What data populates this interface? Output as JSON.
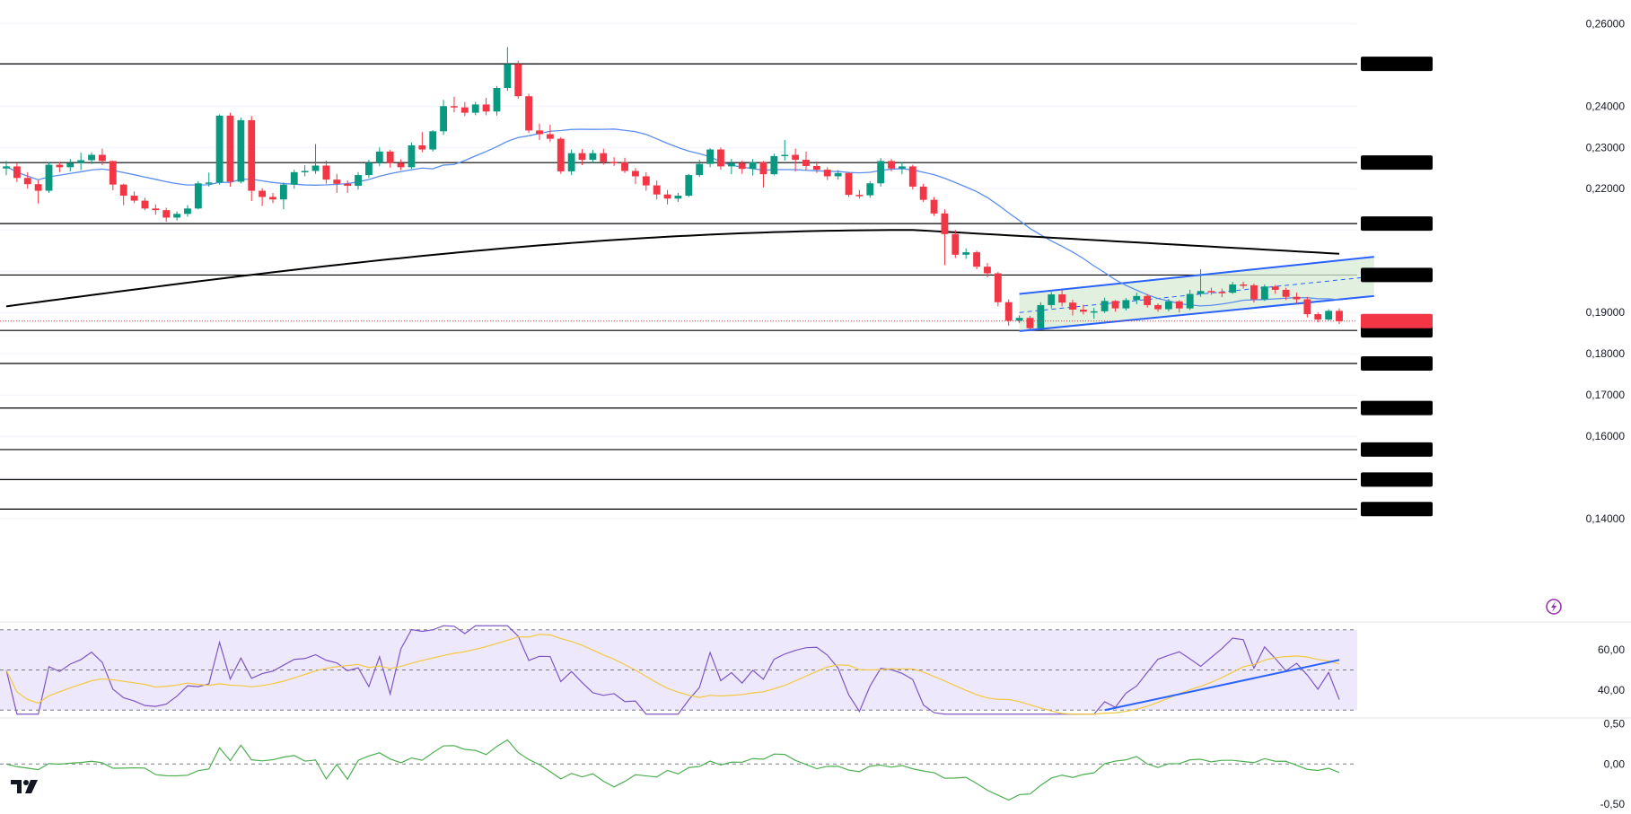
{
  "chart_data": {
    "type": "candlestick",
    "price_axis": {
      "ylim": [
        0.1383,
        0.2618
      ],
      "ticks": [
        "0,26000",
        "0,24000",
        "0,23000",
        "0,22000",
        "0,19000",
        "0,18000",
        "0,17000",
        "0,16000",
        "0,14000"
      ]
    },
    "horizontal_levels": [
      {
        "value": 0.25025,
        "label": "0,25025"
      },
      {
        "value": 0.22632,
        "label": "0,22632"
      },
      {
        "value": 0.21154,
        "label": "0,21154"
      },
      {
        "value": 0.19909,
        "label": "0,19909"
      },
      {
        "value": 0.18566,
        "label": "0,18566"
      },
      {
        "value": 0.17766,
        "label": "0,17766"
      },
      {
        "value": 0.16686,
        "label": "0,16686"
      },
      {
        "value": 0.1568,
        "label": "0,15680"
      },
      {
        "value": 0.14952,
        "label": "0,14952"
      },
      {
        "value": 0.14237,
        "label": "0,14237"
      }
    ],
    "last_price": {
      "value": 0.18792,
      "label": "0,18792",
      "color": "#f23645"
    },
    "colors": {
      "up": "#089981",
      "down": "#f23645",
      "ma_short": "#5b8def",
      "ma_long": "#000000",
      "channel": "#2962ff",
      "channel_fill": "#d8ecd4",
      "rsi": "#7e57c2",
      "rsi_ma": "#f5c842",
      "rsi_band": "#ede8fb",
      "momentum": "#4caf50"
    },
    "candles": [
      [
        0.2249,
        0.2254,
        0.2233,
        0.2267
      ],
      [
        0.2254,
        0.2226,
        0.2216,
        0.2262
      ],
      [
        0.2226,
        0.2211,
        0.22,
        0.224
      ],
      [
        0.2211,
        0.2195,
        0.2164,
        0.2221
      ],
      [
        0.2195,
        0.2258,
        0.219,
        0.2265
      ],
      [
        0.2258,
        0.2252,
        0.224,
        0.2265
      ],
      [
        0.2252,
        0.2262,
        0.2242,
        0.2272
      ],
      [
        0.2262,
        0.2269,
        0.2245,
        0.2287
      ],
      [
        0.2269,
        0.2282,
        0.226,
        0.2288
      ],
      [
        0.2282,
        0.2267,
        0.2257,
        0.2297
      ],
      [
        0.2267,
        0.221,
        0.2196,
        0.2268
      ],
      [
        0.221,
        0.2183,
        0.216,
        0.2212
      ],
      [
        0.2183,
        0.2171,
        0.2165,
        0.2193
      ],
      [
        0.2171,
        0.2152,
        0.2148,
        0.2178
      ],
      [
        0.2152,
        0.2148,
        0.2137,
        0.2162
      ],
      [
        0.2148,
        0.213,
        0.212,
        0.2154
      ],
      [
        0.213,
        0.2139,
        0.2123,
        0.2145
      ],
      [
        0.2139,
        0.2152,
        0.2132,
        0.216
      ],
      [
        0.2152,
        0.2213,
        0.215,
        0.2218
      ],
      [
        0.2213,
        0.2215,
        0.2205,
        0.2239
      ],
      [
        0.2215,
        0.2377,
        0.221,
        0.238
      ],
      [
        0.2377,
        0.2217,
        0.2205,
        0.2384
      ],
      [
        0.2217,
        0.2366,
        0.2213,
        0.2372
      ],
      [
        0.2366,
        0.2195,
        0.217,
        0.2376
      ],
      [
        0.2195,
        0.218,
        0.2158,
        0.2201
      ],
      [
        0.218,
        0.2174,
        0.2165,
        0.219
      ],
      [
        0.2174,
        0.221,
        0.215,
        0.2215
      ],
      [
        0.221,
        0.224,
        0.22,
        0.2246
      ],
      [
        0.224,
        0.2243,
        0.223,
        0.2257
      ],
      [
        0.2243,
        0.2256,
        0.2236,
        0.2308
      ],
      [
        0.2256,
        0.2222,
        0.2212,
        0.2268
      ],
      [
        0.2222,
        0.2212,
        0.219,
        0.2236
      ],
      [
        0.2212,
        0.2207,
        0.219,
        0.222
      ],
      [
        0.2207,
        0.2233,
        0.2198,
        0.224
      ],
      [
        0.2233,
        0.2263,
        0.2226,
        0.227
      ],
      [
        0.2263,
        0.229,
        0.2255,
        0.23
      ],
      [
        0.229,
        0.2262,
        0.2251,
        0.2294
      ],
      [
        0.2262,
        0.2252,
        0.2245,
        0.2271
      ],
      [
        0.2252,
        0.2305,
        0.2248,
        0.2312
      ],
      [
        0.2305,
        0.2295,
        0.2288,
        0.2337
      ],
      [
        0.2295,
        0.2339,
        0.229,
        0.2342
      ],
      [
        0.2339,
        0.24,
        0.233,
        0.2415
      ],
      [
        0.24,
        0.2397,
        0.2385,
        0.2423
      ],
      [
        0.2397,
        0.2384,
        0.2376,
        0.241
      ],
      [
        0.2384,
        0.2404,
        0.2378,
        0.241
      ],
      [
        0.2404,
        0.2387,
        0.2378,
        0.242
      ],
      [
        0.2387,
        0.2444,
        0.2377,
        0.2449
      ],
      [
        0.2444,
        0.2502,
        0.2437,
        0.2543
      ],
      [
        0.2502,
        0.2424,
        0.2418,
        0.251
      ],
      [
        0.2424,
        0.2341,
        0.2335,
        0.243
      ],
      [
        0.2341,
        0.2332,
        0.2318,
        0.2358
      ],
      [
        0.2332,
        0.2321,
        0.2313,
        0.2355
      ],
      [
        0.2321,
        0.2242,
        0.2236,
        0.2325
      ],
      [
        0.2242,
        0.2286,
        0.2233,
        0.2295
      ],
      [
        0.2286,
        0.227,
        0.2257,
        0.2296
      ],
      [
        0.227,
        0.2286,
        0.2263,
        0.2294
      ],
      [
        0.2286,
        0.2265,
        0.2258,
        0.2297
      ],
      [
        0.2265,
        0.2264,
        0.2255,
        0.2276
      ],
      [
        0.2264,
        0.2243,
        0.2238,
        0.2275
      ],
      [
        0.2243,
        0.223,
        0.2211,
        0.225
      ],
      [
        0.223,
        0.2208,
        0.2195,
        0.224
      ],
      [
        0.2208,
        0.2186,
        0.2174,
        0.222
      ],
      [
        0.2186,
        0.2176,
        0.2162,
        0.2197
      ],
      [
        0.2176,
        0.2183,
        0.2168,
        0.219
      ],
      [
        0.2183,
        0.2233,
        0.218,
        0.2236
      ],
      [
        0.2233,
        0.226,
        0.2228,
        0.227
      ],
      [
        0.226,
        0.2295,
        0.2252,
        0.2298
      ],
      [
        0.2295,
        0.2254,
        0.2246,
        0.23
      ],
      [
        0.2254,
        0.2262,
        0.2235,
        0.2272
      ],
      [
        0.2262,
        0.2248,
        0.2236,
        0.2268
      ],
      [
        0.2248,
        0.2264,
        0.2232,
        0.2272
      ],
      [
        0.2264,
        0.2235,
        0.2203,
        0.2267
      ],
      [
        0.2235,
        0.2279,
        0.2232,
        0.2285
      ],
      [
        0.2279,
        0.2282,
        0.2268,
        0.2318
      ],
      [
        0.2282,
        0.227,
        0.2242,
        0.2297
      ],
      [
        0.227,
        0.2255,
        0.2244,
        0.229
      ],
      [
        0.2255,
        0.2246,
        0.2238,
        0.2266
      ],
      [
        0.2246,
        0.223,
        0.2221,
        0.2252
      ],
      [
        0.223,
        0.2238,
        0.2222,
        0.2245
      ],
      [
        0.2238,
        0.2185,
        0.218,
        0.224
      ],
      [
        0.2185,
        0.2184,
        0.2176,
        0.2197
      ],
      [
        0.2184,
        0.2213,
        0.2178,
        0.2218
      ],
      [
        0.2213,
        0.2267,
        0.2205,
        0.2274
      ],
      [
        0.2267,
        0.2249,
        0.2242,
        0.2272
      ],
      [
        0.2249,
        0.2254,
        0.2235,
        0.2265
      ],
      [
        0.2254,
        0.2205,
        0.2198,
        0.2258
      ],
      [
        0.2205,
        0.2173,
        0.2168,
        0.2212
      ],
      [
        0.2173,
        0.214,
        0.2134,
        0.218
      ],
      [
        0.214,
        0.209,
        0.2015,
        0.215
      ],
      [
        0.209,
        0.204,
        0.2032,
        0.21
      ],
      [
        0.204,
        0.2046,
        0.203,
        0.2055
      ],
      [
        0.2046,
        0.2011,
        0.2005,
        0.205
      ],
      [
        0.2011,
        0.1995,
        0.1985,
        0.202
      ],
      [
        0.1995,
        0.1925,
        0.1915,
        0.1998
      ],
      [
        0.1925,
        0.188,
        0.1868,
        0.1932
      ],
      [
        0.188,
        0.1887,
        0.1874,
        0.1893
      ],
      [
        0.1887,
        0.1862,
        0.1855,
        0.1892
      ],
      [
        0.1862,
        0.1918,
        0.186,
        0.1925
      ],
      [
        0.1918,
        0.1944,
        0.191,
        0.195
      ],
      [
        0.1944,
        0.1924,
        0.1915,
        0.1955
      ],
      [
        0.1924,
        0.1907,
        0.1893,
        0.1931
      ],
      [
        0.1907,
        0.1902,
        0.1895,
        0.1919
      ],
      [
        0.1902,
        0.1903,
        0.1885,
        0.1911
      ],
      [
        0.1903,
        0.1928,
        0.1899,
        0.1936
      ],
      [
        0.1928,
        0.191,
        0.1902,
        0.193
      ],
      [
        0.191,
        0.193,
        0.1905,
        0.1935
      ],
      [
        0.193,
        0.194,
        0.192,
        0.1948
      ],
      [
        0.194,
        0.1918,
        0.1912,
        0.1945
      ],
      [
        0.1918,
        0.1908,
        0.1902,
        0.1922
      ],
      [
        0.1908,
        0.1927,
        0.1903,
        0.1933
      ],
      [
        0.1927,
        0.191,
        0.19,
        0.193
      ],
      [
        0.191,
        0.1945,
        0.1906,
        0.1955
      ],
      [
        0.1945,
        0.1952,
        0.1938,
        0.2005
      ],
      [
        0.1952,
        0.195,
        0.1943,
        0.196
      ],
      [
        0.195,
        0.1948,
        0.1937,
        0.1958
      ],
      [
        0.1948,
        0.1968,
        0.1945,
        0.1974
      ],
      [
        0.1968,
        0.1966,
        0.1958,
        0.1975
      ],
      [
        0.1966,
        0.1932,
        0.1924,
        0.197
      ],
      [
        0.1932,
        0.1963,
        0.1928,
        0.1968
      ],
      [
        0.1963,
        0.1955,
        0.1945,
        0.1967
      ],
      [
        0.1955,
        0.1938,
        0.193,
        0.196
      ],
      [
        0.1938,
        0.1932,
        0.1922,
        0.1948
      ],
      [
        0.1932,
        0.1896,
        0.1888,
        0.1938
      ],
      [
        0.1896,
        0.1883,
        0.1876,
        0.19
      ],
      [
        0.1883,
        0.1904,
        0.188,
        0.1908
      ],
      [
        0.1904,
        0.1879,
        0.1872,
        0.191
      ]
    ],
    "rsi_axis": {
      "ylim": [
        27,
        73
      ],
      "ticks": [
        {
          "value": 60,
          "label": "60,00"
        },
        {
          "value": 40,
          "label": "40,00"
        }
      ]
    },
    "momentum_axis": {
      "ylim": [
        -0.6,
        0.55
      ],
      "ticks": [
        {
          "value": 0.5,
          "label": "0,50"
        },
        {
          "value": 0,
          "label": "0,00"
        },
        {
          "value": -0.5,
          "label": "-0,50"
        }
      ]
    }
  }
}
